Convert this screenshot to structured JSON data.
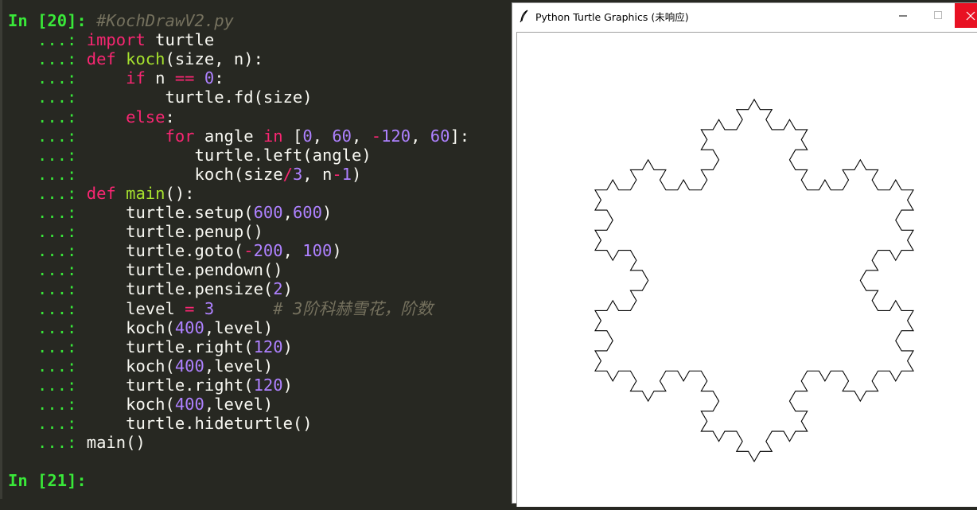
{
  "terminal": {
    "lines": [
      [
        {
          "t": "In [",
          "c": "pnum"
        },
        {
          "t": "20",
          "c": "pnum"
        },
        {
          "t": "]: ",
          "c": "pnum"
        },
        {
          "t": "#KochDrawV2.py",
          "c": "cmt"
        }
      ],
      [
        {
          "t": "   ...: ",
          "c": "prompt"
        },
        {
          "t": "import",
          "c": "kw"
        },
        {
          "t": " turtle",
          "c": ""
        }
      ],
      [
        {
          "t": "   ...: ",
          "c": "prompt"
        },
        {
          "t": "def",
          "c": "kw"
        },
        {
          "t": " ",
          "c": ""
        },
        {
          "t": "koch",
          "c": "fn"
        },
        {
          "t": "(size, n):",
          "c": ""
        }
      ],
      [
        {
          "t": "   ...: ",
          "c": "prompt"
        },
        {
          "t": "    ",
          "c": ""
        },
        {
          "t": "if",
          "c": "kw"
        },
        {
          "t": " n ",
          "c": ""
        },
        {
          "t": "==",
          "c": "kw"
        },
        {
          "t": " ",
          "c": ""
        },
        {
          "t": "0",
          "c": "num"
        },
        {
          "t": ":",
          "c": ""
        }
      ],
      [
        {
          "t": "   ...: ",
          "c": "prompt"
        },
        {
          "t": "        turtle.fd(size)",
          "c": ""
        }
      ],
      [
        {
          "t": "   ...: ",
          "c": "prompt"
        },
        {
          "t": "    ",
          "c": ""
        },
        {
          "t": "else",
          "c": "kw"
        },
        {
          "t": ":",
          "c": ""
        }
      ],
      [
        {
          "t": "   ...: ",
          "c": "prompt"
        },
        {
          "t": "        ",
          "c": ""
        },
        {
          "t": "for",
          "c": "kw"
        },
        {
          "t": " angle ",
          "c": ""
        },
        {
          "t": "in",
          "c": "kw"
        },
        {
          "t": " [",
          "c": ""
        },
        {
          "t": "0",
          "c": "num"
        },
        {
          "t": ", ",
          "c": ""
        },
        {
          "t": "60",
          "c": "num"
        },
        {
          "t": ", ",
          "c": ""
        },
        {
          "t": "-",
          "c": "kw"
        },
        {
          "t": "120",
          "c": "num"
        },
        {
          "t": ", ",
          "c": ""
        },
        {
          "t": "60",
          "c": "num"
        },
        {
          "t": "]:",
          "c": ""
        }
      ],
      [
        {
          "t": "   ...: ",
          "c": "prompt"
        },
        {
          "t": "           turtle.left(angle)",
          "c": ""
        }
      ],
      [
        {
          "t": "   ...: ",
          "c": "prompt"
        },
        {
          "t": "           koch(size",
          "c": ""
        },
        {
          "t": "/",
          "c": "kw"
        },
        {
          "t": "3",
          "c": "num"
        },
        {
          "t": ", n",
          "c": ""
        },
        {
          "t": "-",
          "c": "kw"
        },
        {
          "t": "1",
          "c": "num"
        },
        {
          "t": ")",
          "c": ""
        }
      ],
      [
        {
          "t": "   ...: ",
          "c": "prompt"
        },
        {
          "t": "def",
          "c": "kw"
        },
        {
          "t": " ",
          "c": ""
        },
        {
          "t": "main",
          "c": "fn"
        },
        {
          "t": "():",
          "c": ""
        }
      ],
      [
        {
          "t": "   ...: ",
          "c": "prompt"
        },
        {
          "t": "    turtle.setup(",
          "c": ""
        },
        {
          "t": "600",
          "c": "num"
        },
        {
          "t": ",",
          "c": ""
        },
        {
          "t": "600",
          "c": "num"
        },
        {
          "t": ")",
          "c": ""
        }
      ],
      [
        {
          "t": "   ...: ",
          "c": "prompt"
        },
        {
          "t": "    turtle.penup()",
          "c": ""
        }
      ],
      [
        {
          "t": "   ...: ",
          "c": "prompt"
        },
        {
          "t": "    turtle.goto(",
          "c": ""
        },
        {
          "t": "-",
          "c": "kw"
        },
        {
          "t": "200",
          "c": "num"
        },
        {
          "t": ", ",
          "c": ""
        },
        {
          "t": "100",
          "c": "num"
        },
        {
          "t": ")",
          "c": ""
        }
      ],
      [
        {
          "t": "   ...: ",
          "c": "prompt"
        },
        {
          "t": "    turtle.pendown()",
          "c": ""
        }
      ],
      [
        {
          "t": "   ...: ",
          "c": "prompt"
        },
        {
          "t": "    turtle.pensize(",
          "c": ""
        },
        {
          "t": "2",
          "c": "num"
        },
        {
          "t": ")",
          "c": ""
        }
      ],
      [
        {
          "t": "   ...: ",
          "c": "prompt"
        },
        {
          "t": "    level ",
          "c": ""
        },
        {
          "t": "=",
          "c": "kw"
        },
        {
          "t": " ",
          "c": ""
        },
        {
          "t": "3",
          "c": "num"
        },
        {
          "t": "      ",
          "c": ""
        },
        {
          "t": "# 3阶科赫雪花，阶数",
          "c": "cmt"
        }
      ],
      [
        {
          "t": "   ...: ",
          "c": "prompt"
        },
        {
          "t": "    koch(",
          "c": ""
        },
        {
          "t": "400",
          "c": "num"
        },
        {
          "t": ",level)",
          "c": ""
        }
      ],
      [
        {
          "t": "   ...: ",
          "c": "prompt"
        },
        {
          "t": "    turtle.right(",
          "c": ""
        },
        {
          "t": "120",
          "c": "num"
        },
        {
          "t": ")",
          "c": ""
        }
      ],
      [
        {
          "t": "   ...: ",
          "c": "prompt"
        },
        {
          "t": "    koch(",
          "c": ""
        },
        {
          "t": "400",
          "c": "num"
        },
        {
          "t": ",level)",
          "c": ""
        }
      ],
      [
        {
          "t": "   ...: ",
          "c": "prompt"
        },
        {
          "t": "    turtle.right(",
          "c": ""
        },
        {
          "t": "120",
          "c": "num"
        },
        {
          "t": ")",
          "c": ""
        }
      ],
      [
        {
          "t": "   ...: ",
          "c": "prompt"
        },
        {
          "t": "    koch(",
          "c": ""
        },
        {
          "t": "400",
          "c": "num"
        },
        {
          "t": ",level)",
          "c": ""
        }
      ],
      [
        {
          "t": "   ...: ",
          "c": "prompt"
        },
        {
          "t": "    turtle.hideturtle()",
          "c": ""
        }
      ],
      [
        {
          "t": "   ...: ",
          "c": "prompt"
        },
        {
          "t": "main()",
          "c": ""
        }
      ],
      [],
      [
        {
          "t": "In [",
          "c": "pnum"
        },
        {
          "t": "21",
          "c": "pnum"
        },
        {
          "t": "]: ",
          "c": "pnum"
        }
      ]
    ]
  },
  "window": {
    "title": "Python Turtle Graphics (未响应)",
    "minimize_glyph": "—",
    "maximize_glyph": "☐",
    "close_glyph": "✕"
  },
  "koch": {
    "size": 400,
    "level": 3,
    "stroke_color": "#000000"
  },
  "colors": {
    "terminal_bg": "#272822",
    "prompt": "#39e839",
    "keyword": "#f92672",
    "function": "#a6e22e",
    "number": "#ae81ff",
    "comment": "#75715e",
    "close_button": "#e81123"
  }
}
